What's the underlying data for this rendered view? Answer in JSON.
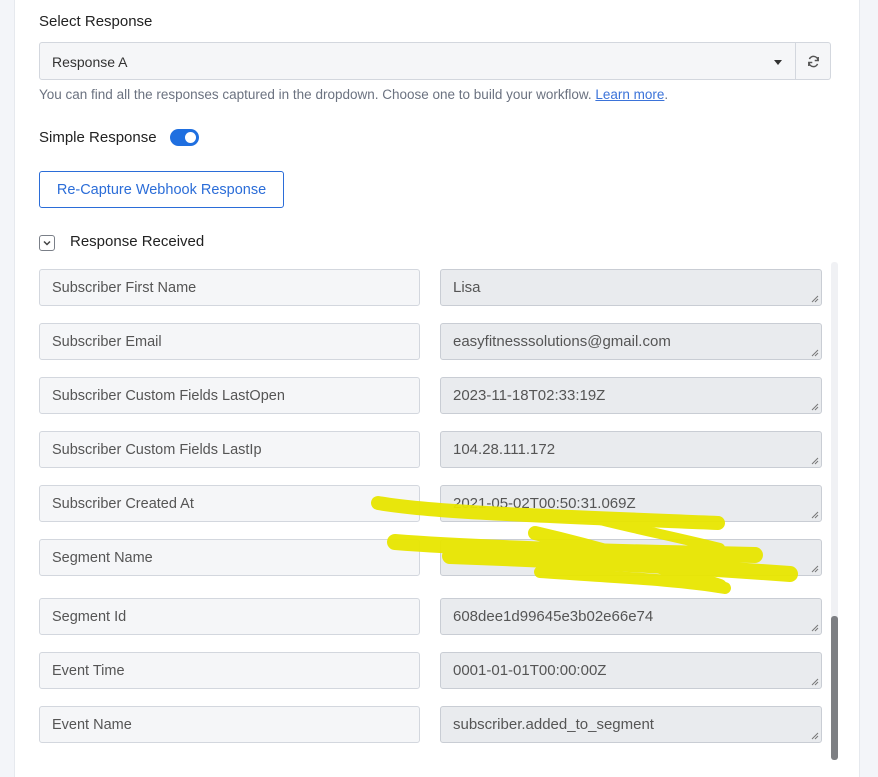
{
  "select_response": {
    "label": "Select Response",
    "selected": "Response A",
    "help_text": "You can find all the responses captured in the dropdown. Choose one to build your workflow.",
    "help_link": "Learn more",
    "help_suffix": "."
  },
  "simple_response": {
    "label": "Simple Response",
    "enabled": true
  },
  "recapture_button": "Re-Capture Webhook Response",
  "response_received": {
    "label": "Response Received",
    "fields": [
      {
        "name": "Subscriber First Name",
        "value": "Lisa"
      },
      {
        "name": "Subscriber Email",
        "value": "easyfitnesssolutions@gmail.com"
      },
      {
        "name": "Subscriber Custom Fields LastOpen",
        "value": "2023-11-18T02:33:19Z"
      },
      {
        "name": "Subscriber Custom Fields LastIp",
        "value": "104.28.111.172"
      },
      {
        "name": "Subscriber Created At",
        "value": "2021-05-02T00:50:31.069Z"
      },
      {
        "name": "Segment Name",
        "value": ""
      },
      {
        "name": "Segment Id",
        "value": "608dee1d99645e3b02e66e74"
      },
      {
        "name": "Event Time",
        "value": "0001-01-01T00:00:00Z"
      },
      {
        "name": "Event Name",
        "value": "subscriber.added_to_segment"
      }
    ]
  },
  "colors": {
    "accent": "#1f6fe0",
    "redaction": "#e8e600"
  },
  "icons": {
    "refresh": "refresh-icon",
    "dropdown": "caret-down-icon",
    "collapse": "chevron-down-icon"
  }
}
